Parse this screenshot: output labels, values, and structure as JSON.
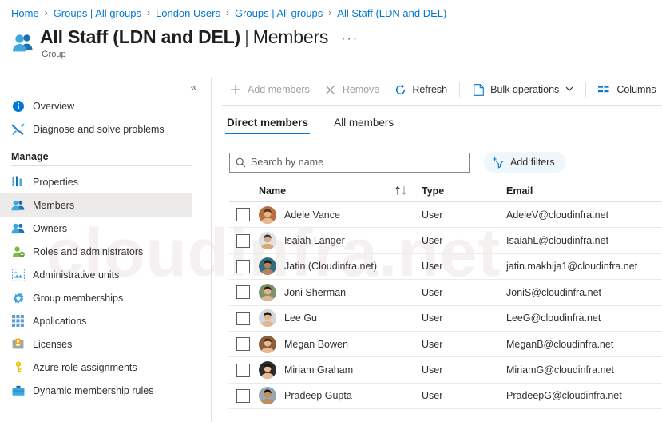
{
  "breadcrumb": [
    {
      "label": "Home"
    },
    {
      "label": "Groups | All groups"
    },
    {
      "label": "London Users"
    },
    {
      "label": "Groups | All groups"
    },
    {
      "label": "All Staff (LDN and DEL)"
    }
  ],
  "header": {
    "title": "All Staff (LDN and DEL)",
    "separator": "|",
    "section": "Members",
    "ellipsis": "···",
    "subtitle": "Group",
    "icon": "group-people-icon"
  },
  "watermark": "cloudinfra.net",
  "sidebar": {
    "collapse_glyph": "«",
    "top_items": [
      {
        "label": "Overview",
        "icon": "info-icon"
      },
      {
        "label": "Diagnose and solve problems",
        "icon": "wrench-icon"
      }
    ],
    "section_label": "Manage",
    "manage_items": [
      {
        "label": "Properties",
        "icon": "properties-icon",
        "active": false
      },
      {
        "label": "Members",
        "icon": "members-icon",
        "active": true
      },
      {
        "label": "Owners",
        "icon": "owners-icon",
        "active": false
      },
      {
        "label": "Roles and administrators",
        "icon": "roles-icon",
        "active": false
      },
      {
        "label": "Administrative units",
        "icon": "admin-units-icon",
        "active": false
      },
      {
        "label": "Group memberships",
        "icon": "group-memberships-icon",
        "active": false
      },
      {
        "label": "Applications",
        "icon": "applications-icon",
        "active": false
      },
      {
        "label": "Licenses",
        "icon": "licenses-icon",
        "active": false
      },
      {
        "label": "Azure role assignments",
        "icon": "key-icon",
        "active": false
      },
      {
        "label": "Dynamic membership rules",
        "icon": "dynamic-rules-icon",
        "active": false
      }
    ]
  },
  "toolbar": {
    "add_members": "Add members",
    "remove": "Remove",
    "refresh": "Refresh",
    "bulk_operations": "Bulk operations",
    "columns": "Columns",
    "caret": "∨"
  },
  "tabs": [
    {
      "label": "Direct members",
      "active": true
    },
    {
      "label": "All members",
      "active": false
    }
  ],
  "search": {
    "placeholder": "Search by name",
    "value": "",
    "add_filters_label": "Add filters"
  },
  "table": {
    "columns": {
      "name": "Name",
      "type": "Type",
      "email": "Email"
    },
    "rows": [
      {
        "name": "Adele Vance",
        "type": "User",
        "email": "AdeleV@cloudinfra.net",
        "avatar_bg": "#b8703f",
        "skin": "#e8b88f",
        "hair": "#5a3a22"
      },
      {
        "name": "Isaiah Langer",
        "type": "User",
        "email": "IsaiahL@cloudinfra.net",
        "avatar_bg": "#dfe3e6",
        "skin": "#d9a87a",
        "hair": "#3a3a3a"
      },
      {
        "name": "Jatin (Cloudinfra.net)",
        "type": "User",
        "email": "jatin.makhija1@cloudinfra.net",
        "avatar_bg": "#2f6f7e",
        "skin": "#b5845c",
        "hair": "#201914"
      },
      {
        "name": "Joni Sherman",
        "type": "User",
        "email": "JoniS@cloudinfra.net",
        "avatar_bg": "#7e9466",
        "skin": "#e0b492",
        "hair": "#2b2019"
      },
      {
        "name": "Lee Gu",
        "type": "User",
        "email": "LeeG@cloudinfra.net",
        "avatar_bg": "#cfd6dc",
        "skin": "#e3b58c",
        "hair": "#241c16"
      },
      {
        "name": "Megan Bowen",
        "type": "User",
        "email": "MeganB@cloudinfra.net",
        "avatar_bg": "#8b5e3c",
        "skin": "#e8b88f",
        "hair": "#4a3222"
      },
      {
        "name": "Miriam Graham",
        "type": "User",
        "email": "MiriamG@cloudinfra.net",
        "avatar_bg": "#2b2b2b",
        "skin": "#e7bb95",
        "hair": "#1a1410"
      },
      {
        "name": "Pradeep Gupta",
        "type": "User",
        "email": "PradeepG@cloudinfra.net",
        "avatar_bg": "#9aa7b0",
        "skin": "#c08d5e",
        "hair": "#191310"
      }
    ]
  },
  "colors": {
    "accent": "#0078d4",
    "text": "#323130",
    "muted": "#605e5c",
    "disabled": "#a19f9d",
    "active_row": "#edebe9",
    "border": "#e1dfdd"
  }
}
